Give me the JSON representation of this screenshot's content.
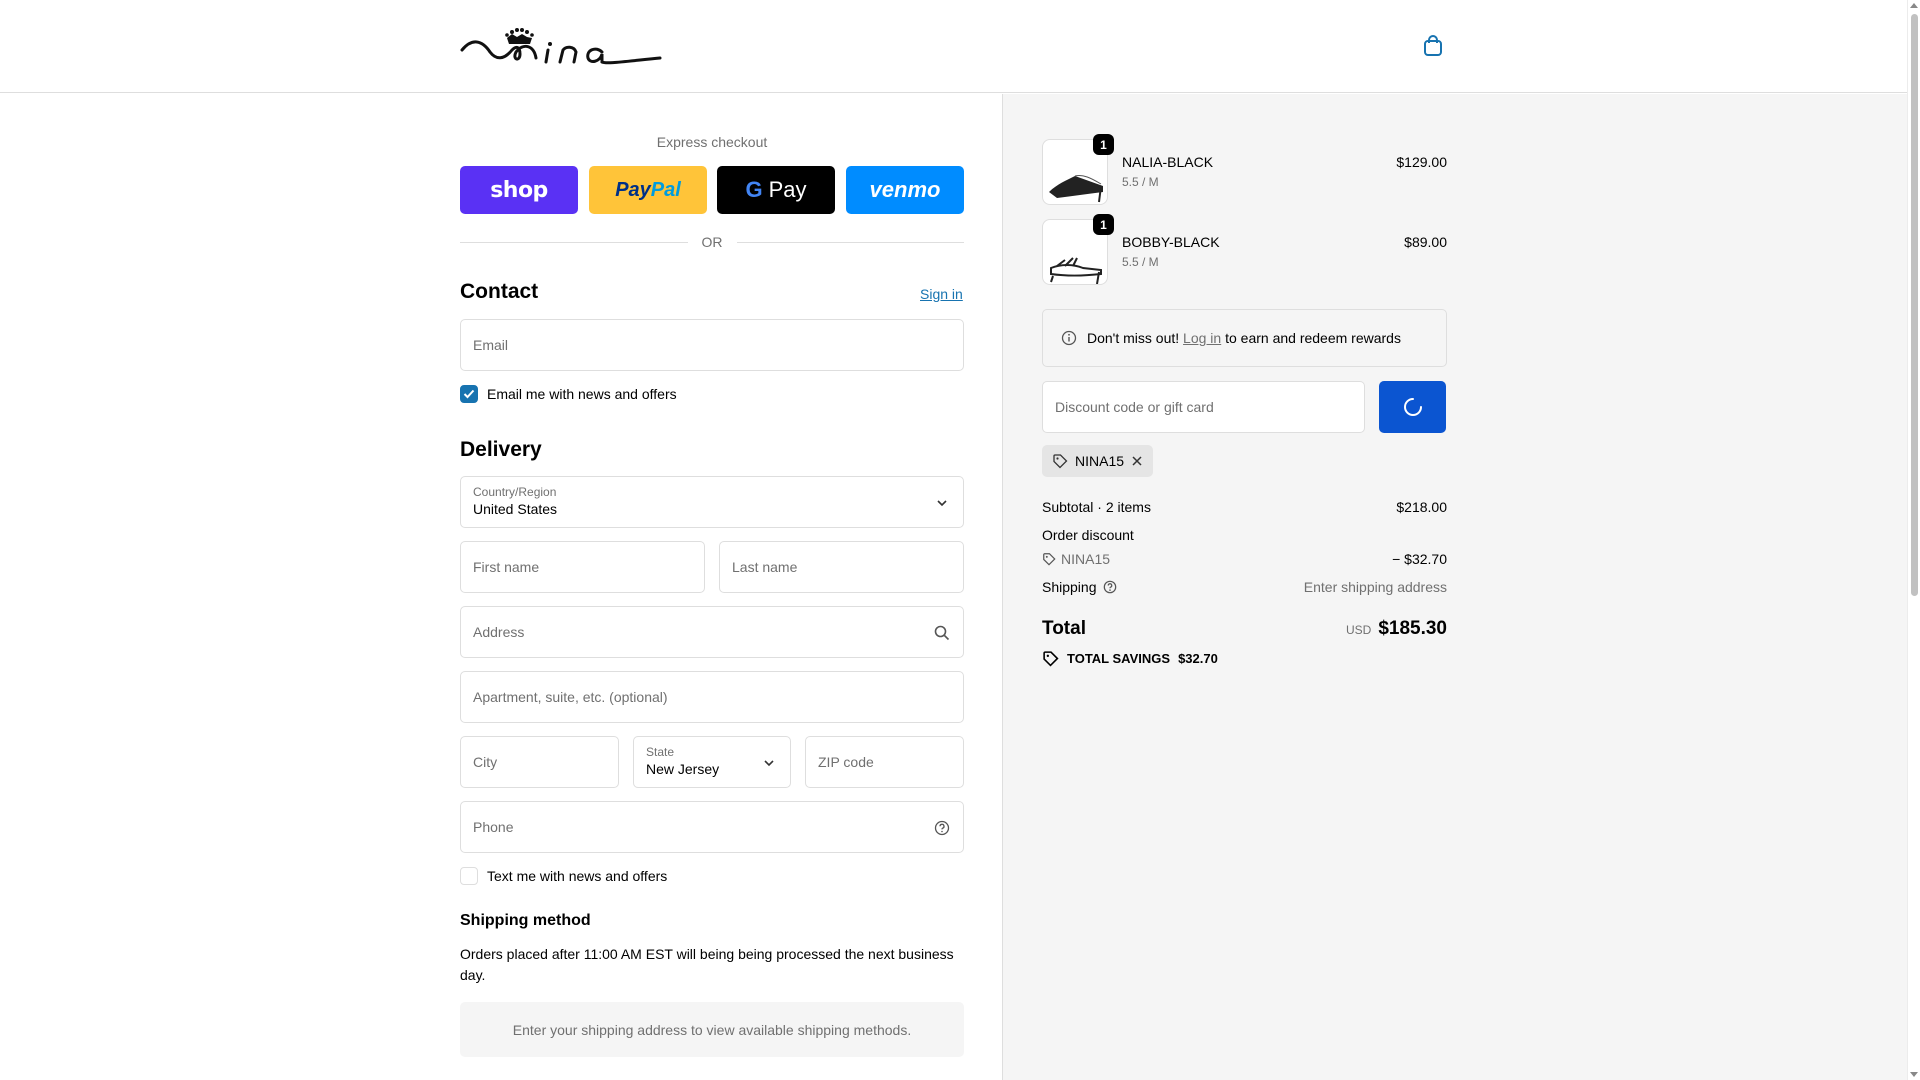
{
  "header": {
    "logo_alt": "nina"
  },
  "express": {
    "title": "Express checkout",
    "shop": "shop",
    "paypal_a": "Pay",
    "paypal_b": "Pal",
    "gpay": "Pay",
    "venmo": "venmo",
    "or": "OR"
  },
  "contact": {
    "title": "Contact",
    "signin": "Sign in",
    "email_placeholder": "Email",
    "news_label": "Email me with news and offers",
    "news_checked": true
  },
  "delivery": {
    "title": "Delivery",
    "country_label": "Country/Region",
    "country_value": "United States",
    "first_name": "First name",
    "last_name": "Last name",
    "address": "Address",
    "apartment": "Apartment, suite, etc. (optional)",
    "city": "City",
    "state_label": "State",
    "state_value": "New Jersey",
    "zip": "ZIP code",
    "phone": "Phone",
    "sms_label": "Text me with news and offers"
  },
  "shipping_method": {
    "title": "Shipping method",
    "note": "Orders placed after 11:00 AM EST will being being processed the next business day.",
    "empty": "Enter your shipping address to view available shipping methods."
  },
  "cart": {
    "items": [
      {
        "qty": "1",
        "name": "NALIA-BLACK",
        "variant": "5.5 / M",
        "price": "$129.00"
      },
      {
        "qty": "1",
        "name": "BOBBY-BLACK",
        "variant": "5.5 / M",
        "price": "$89.00"
      }
    ]
  },
  "rewards": {
    "pre": "Don't miss out!",
    "link": "Log in",
    "post": "to earn and redeem rewards"
  },
  "discount": {
    "placeholder": "Discount code or gift card",
    "applied_code": "NINA15"
  },
  "summary": {
    "subtotal_label": "Subtotal · 2 items",
    "subtotal_value": "$218.00",
    "order_discount_label": "Order discount",
    "discount_code": "NINA15",
    "discount_value": "− $32.70",
    "shipping_label": "Shipping",
    "shipping_value": "Enter shipping address",
    "total_label": "Total",
    "currency": "USD",
    "total_value": "$185.30",
    "savings_label": "TOTAL SAVINGS",
    "savings_value": "$32.70"
  },
  "colors": {
    "accent": "#1773b0",
    "apply_button": "#0b55d1",
    "shop_pay": "#5a31f4",
    "paypal": "#ffc439",
    "venmo": "#008cff"
  }
}
